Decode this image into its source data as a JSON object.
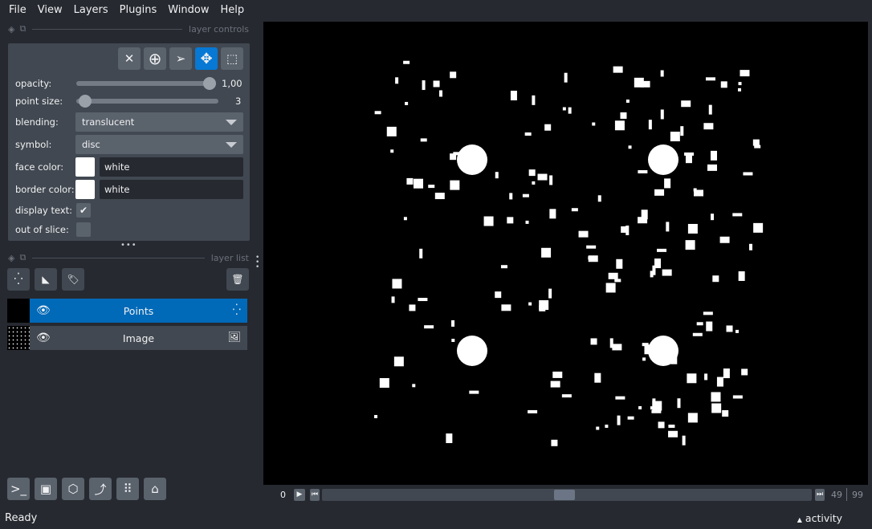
{
  "menu": [
    "File",
    "View",
    "Layers",
    "Plugins",
    "Window",
    "Help"
  ],
  "layer_controls": {
    "title": "layer controls",
    "tools": [
      {
        "icon": "close-icon",
        "glyph": "✕"
      },
      {
        "icon": "add-point-icon",
        "glyph": "⊕"
      },
      {
        "icon": "select-arrow-icon",
        "glyph": "➢"
      },
      {
        "icon": "pan-zoom-icon",
        "glyph": "✥",
        "active": true
      },
      {
        "icon": "lasso-select-icon",
        "glyph": "⬚"
      }
    ],
    "opacity": {
      "label": "opacity:",
      "value": 1.0,
      "display": "1,00"
    },
    "point_size": {
      "label": "point size:",
      "value": 3,
      "display": "3"
    },
    "blending": {
      "label": "blending:",
      "value": "translucent"
    },
    "symbol": {
      "label": "symbol:",
      "value": "disc"
    },
    "face_color": {
      "label": "face color:",
      "value": "white"
    },
    "border_color": {
      "label": "border color:",
      "value": "white"
    },
    "display_text": {
      "label": "display text:",
      "checked": true
    },
    "out_of_slice": {
      "label": "out of slice:",
      "checked": false
    }
  },
  "layer_list": {
    "title": "layer list",
    "layers": [
      {
        "name": "Points",
        "selected": true,
        "visible": true,
        "type_icon": "points-icon"
      },
      {
        "name": "Image",
        "selected": false,
        "visible": true,
        "type_icon": "image-icon"
      }
    ]
  },
  "dims": {
    "current": "0",
    "value": 49,
    "max": "99",
    "value_display": "49"
  },
  "status": "Ready",
  "activity": "activity",
  "colors": {
    "accent": "#0778d4",
    "background": "#262930",
    "panel": "#414851"
  }
}
